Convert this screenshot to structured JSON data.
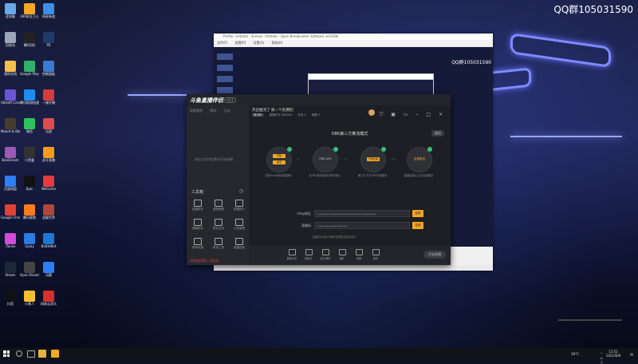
{
  "watermark": "QQ群105031590",
  "desktop_icons": [
    {
      "label": "此电脑",
      "color": "#6aa9e8"
    },
    {
      "label": "360安全卫士",
      "color": "#f5a623"
    },
    {
      "label": "网易有道",
      "color": "#3c8fe6"
    },
    {
      "label": "回收站",
      "color": "#9aa7b8"
    },
    {
      "label": "腾讯QQ",
      "color": "#222"
    },
    {
      "label": "PS",
      "color": "#1f3a6b"
    },
    {
      "label": "我的文档",
      "color": "#f4c04a"
    },
    {
      "label": "Google Play",
      "color": "#2fb36b"
    },
    {
      "label": "控制面板",
      "color": "#3a7bd5"
    },
    {
      "label": "Ubisoft Connect",
      "color": "#6a55d8"
    },
    {
      "label": "腾讯网游加速器",
      "color": "#1d8cf0"
    },
    {
      "label": "一键开播",
      "color": "#d23c3c"
    },
    {
      "label": "Mount & Blade",
      "color": "#4a3c2c"
    },
    {
      "label": "微信",
      "color": "#2fc25b"
    },
    {
      "label": "迅游",
      "color": "#e04a4a"
    },
    {
      "label": "BanDream",
      "color": "#9b59b6"
    },
    {
      "label": "小黑盒",
      "color": "#333"
    },
    {
      "label": "虎牙直播",
      "color": "#f59c1a"
    },
    {
      "label": "百度网盘",
      "color": "#2d7ef7"
    },
    {
      "label": "Epic",
      "color": "#111"
    },
    {
      "label": "WeGame",
      "color": "#e83c3c"
    },
    {
      "label": "Google Chrome",
      "color": "#e34133"
    },
    {
      "label": "腾讯视频",
      "color": "#ff7a1a"
    },
    {
      "label": "战舰世界",
      "color": "#b0453b"
    },
    {
      "label": "iTunes",
      "color": "#cf4bd8"
    },
    {
      "label": "Uplay",
      "color": "#2b7be4"
    },
    {
      "label": "BattleNet",
      "color": "#1c78d4"
    },
    {
      "label": "Steam",
      "color": "#1b2838"
    },
    {
      "label": "Open Broadcaster",
      "color": "#444"
    },
    {
      "label": "迅雷",
      "color": "#2d7ef7"
    },
    {
      "label": "抖音",
      "color": "#111"
    },
    {
      "label": "小黄人",
      "color": "#f0c030"
    },
    {
      "label": "网易云音乐",
      "color": "#d6302c"
    }
  ],
  "obs": {
    "title": "Profile: Untitled - Scenes: Untitled - Open Broadcaster Software v0.659b",
    "menu": [
      "文件(F)",
      "配置(P)",
      "设置(S)",
      "帮助(H)"
    ],
    "qq_overlay": "QQ群105031590"
  },
  "app": {
    "logo": "斗鱼直播伴侣",
    "version": "v5.2",
    "sidebar_tabs": [
      "场景管理",
      "素材",
      "互动"
    ],
    "sidebar_empty": "请在左侧添加素材开始直播",
    "tools_title": "工具箱",
    "tools": [
      {
        "label": "直播助手"
      },
      {
        "label": "道具管理"
      },
      {
        "label": "数据统计"
      },
      {
        "label": "弹幕助手"
      },
      {
        "label": "粉丝互动"
      },
      {
        "label": "公告管理"
      },
      {
        "label": "房间设置"
      },
      {
        "label": "更多工具"
      },
      {
        "label": "直播回放"
      }
    ],
    "sidebar_footer": "如何使用第三方推流",
    "room_title": "开启推流了 第一个房间",
    "room_badge": "娱乐",
    "room_meta": [
      "推流码",
      "直播时长 000000",
      "在线 0",
      "观看 0"
    ],
    "mode_title": "OBS第三方推流模式",
    "exit_label": "退出",
    "steps": [
      {
        "top": "开始",
        "bottom": "推流",
        "caption": "复制rtmp地址和直播码"
      },
      {
        "text": "OBS-URL",
        "caption": "在OBS推流设置中填写地址"
      },
      {
        "btn": "开始直播",
        "caption": "第三步 打开OBS开始推流"
      },
      {
        "btn": "结束推流",
        "caption": "直播结束后 点击结束推流"
      }
    ],
    "rtmp_label": "rtmp地址",
    "rtmp_value": "•••••••••••••••••••••••••••••••",
    "key_label": "直播码",
    "key_value": "••••••••••••••••",
    "copy_label": "复制",
    "note": "直播码在每次开播时需重新复制并填写",
    "bottom_tools": [
      {
        "label": "屏幕共享"
      },
      {
        "label": "摄像头"
      },
      {
        "label": "窗口捕获"
      },
      {
        "label": "图片"
      },
      {
        "label": "音频"
      },
      {
        "label": "更多"
      }
    ],
    "start_label": "开始直播"
  },
  "taskbar": {
    "temperature": "28°C",
    "time": "13:51",
    "date": "2021/6/8"
  }
}
